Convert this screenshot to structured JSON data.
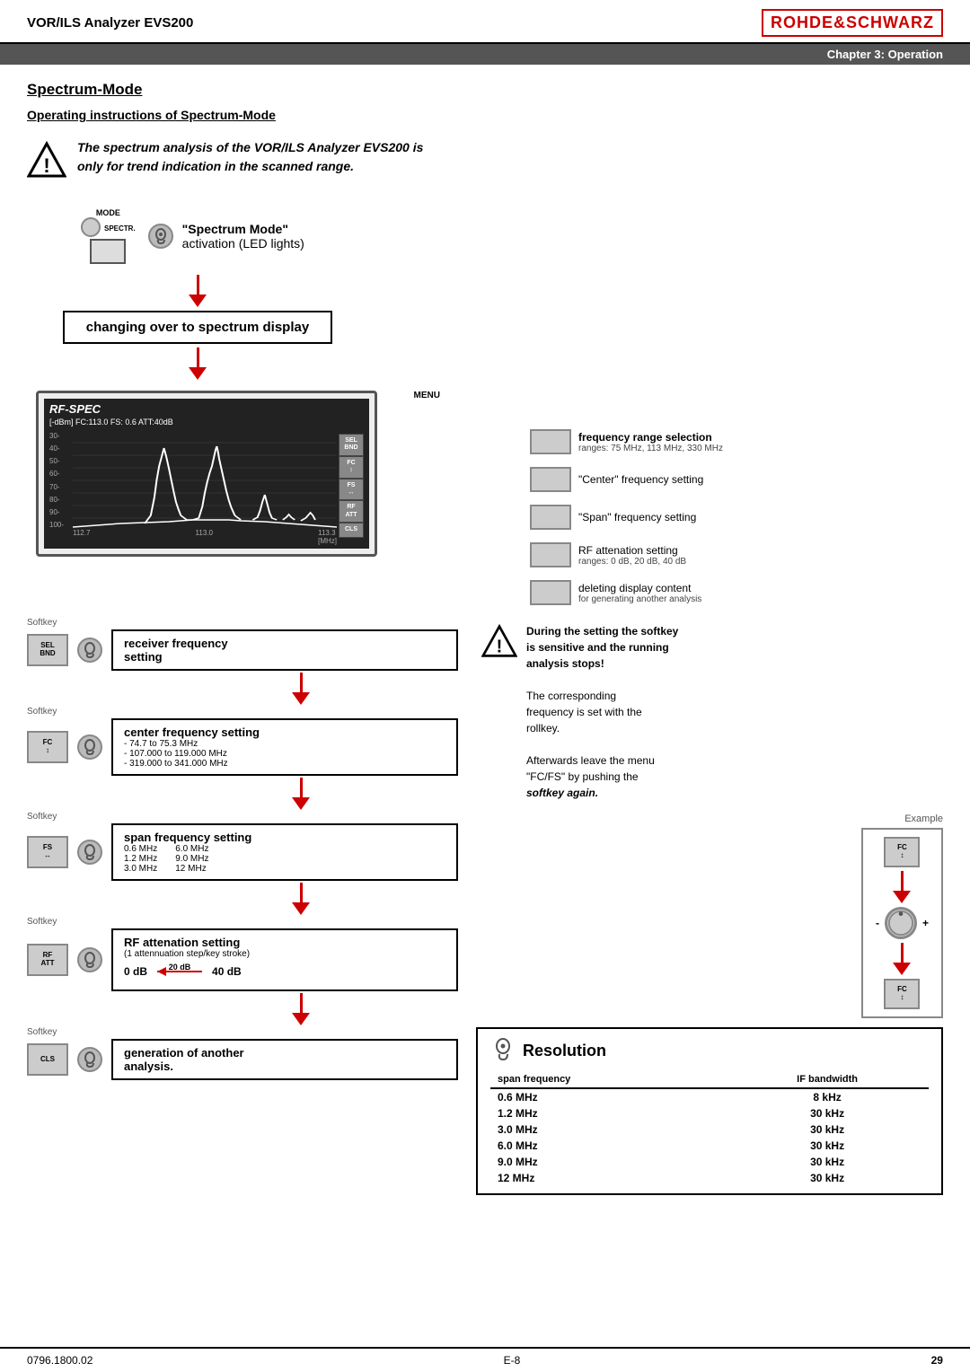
{
  "header": {
    "title": "VOR/ILS Analyzer EVS200",
    "logo": "ROHDE&SCHWARZ",
    "chapter": "Chapter 3: Operation"
  },
  "section": {
    "title": "Spectrum-Mode",
    "subsection": "Operating instructions of Spectrum-Mode"
  },
  "warning": {
    "text1": "The spectrum analysis of the VOR/ILS Analyzer EVS200 is",
    "text2": "only for trend indication in the scanned range."
  },
  "flow": {
    "spectrum_mode_label": "\"Spectrum Mode\"",
    "activation_label": "activation (LED lights)",
    "changing_box": "changing over to spectrum display",
    "menu_label": "MENU",
    "mode_label": "MODE",
    "spectr_label": "SPECTR."
  },
  "screen": {
    "title": "RF-SPEC",
    "info": "[-dBm] FC:113.0  FS: 0.6  ATT:40dB",
    "yaxis": [
      "30",
      "40",
      "50",
      "60",
      "70",
      "80",
      "90",
      "100"
    ],
    "xaxis": [
      "112.7",
      "113.0",
      "113.3\n[MHz]"
    ],
    "buttons": [
      "SEL\nBND",
      "FC\n↕",
      "FS\n↔",
      "RF\nATT",
      "CLS"
    ]
  },
  "softkeys_right": [
    {
      "label": "frequency range selection",
      "sublabel": "ranges:  75 MHz, 113 MHz, 330 MHz"
    },
    {
      "label": "\"Center\" frequency setting",
      "sublabel": ""
    },
    {
      "label": "\"Span\" frequency setting",
      "sublabel": ""
    },
    {
      "label": "RF attenation setting",
      "sublabel": "ranges:  0 dB, 20 dB, 40 dB"
    },
    {
      "label": "deleting display content",
      "sublabel": "for generating another analysis"
    }
  ],
  "steps": [
    {
      "softkey_top": "Softkey",
      "softkey_key": "SEL\nBND",
      "label": "receiver frequency setting"
    },
    {
      "softkey_top": "Softkey",
      "softkey_key": "FC\n↕",
      "label": "center frequency setting",
      "subs": [
        "- 74.7 to 75.3 MHz",
        "- 107.000 to 119.000 MHz",
        "- 319.000 to 341.000 MHz"
      ]
    },
    {
      "softkey_top": "Softkey",
      "softkey_key": "FS\n↔",
      "label": "span frequency setting",
      "subs": [
        [
          "0.6 MHz",
          "6.0 MHz"
        ],
        [
          "1.2 MHz",
          "9.0 MHz"
        ],
        [
          "3.0 MHz",
          "12 MHz"
        ]
      ]
    },
    {
      "softkey_top": "Softkey",
      "softkey_key": "RF\nATT",
      "label": "RF attenation setting",
      "sub": "(1 attennuation step/key stroke)",
      "atten": {
        "left": "0 dB",
        "mid": "20 dB",
        "right": "40 dB"
      }
    },
    {
      "softkey_top": "Softkey",
      "softkey_key": "CLS",
      "label": "generation of another analysis."
    }
  ],
  "warning2": {
    "line1": "During the setting the softkey",
    "line2": "is sensitive and the running",
    "line3": "analysis stops!",
    "line4": "The corresponding",
    "line5": "frequency is set with the",
    "line6": "rollkey.",
    "line7": "Afterwards leave the menu",
    "line8": "\"FC/FS\" by pushing the",
    "line9": "softkey again."
  },
  "example": {
    "label": "Example",
    "btn_label": "FC\n↕",
    "plus": "+",
    "minus": "-"
  },
  "resolution": {
    "title": "Resolution",
    "col1": "span frequency",
    "col2": "IF bandwidth",
    "rows": [
      {
        "span": "0.6 MHz",
        "bw": "8 kHz"
      },
      {
        "span": "1.2 MHz",
        "bw": "30 kHz"
      },
      {
        "span": "3.0 MHz",
        "bw": "30 kHz"
      },
      {
        "span": "6.0 MHz",
        "bw": "30 kHz"
      },
      {
        "span": "9.0 MHz",
        "bw": "30 kHz"
      },
      {
        "span": "12 MHz",
        "bw": "30 kHz"
      }
    ]
  },
  "footer": {
    "left": "0796.1800.02",
    "center": "E-8",
    "right": "29"
  }
}
